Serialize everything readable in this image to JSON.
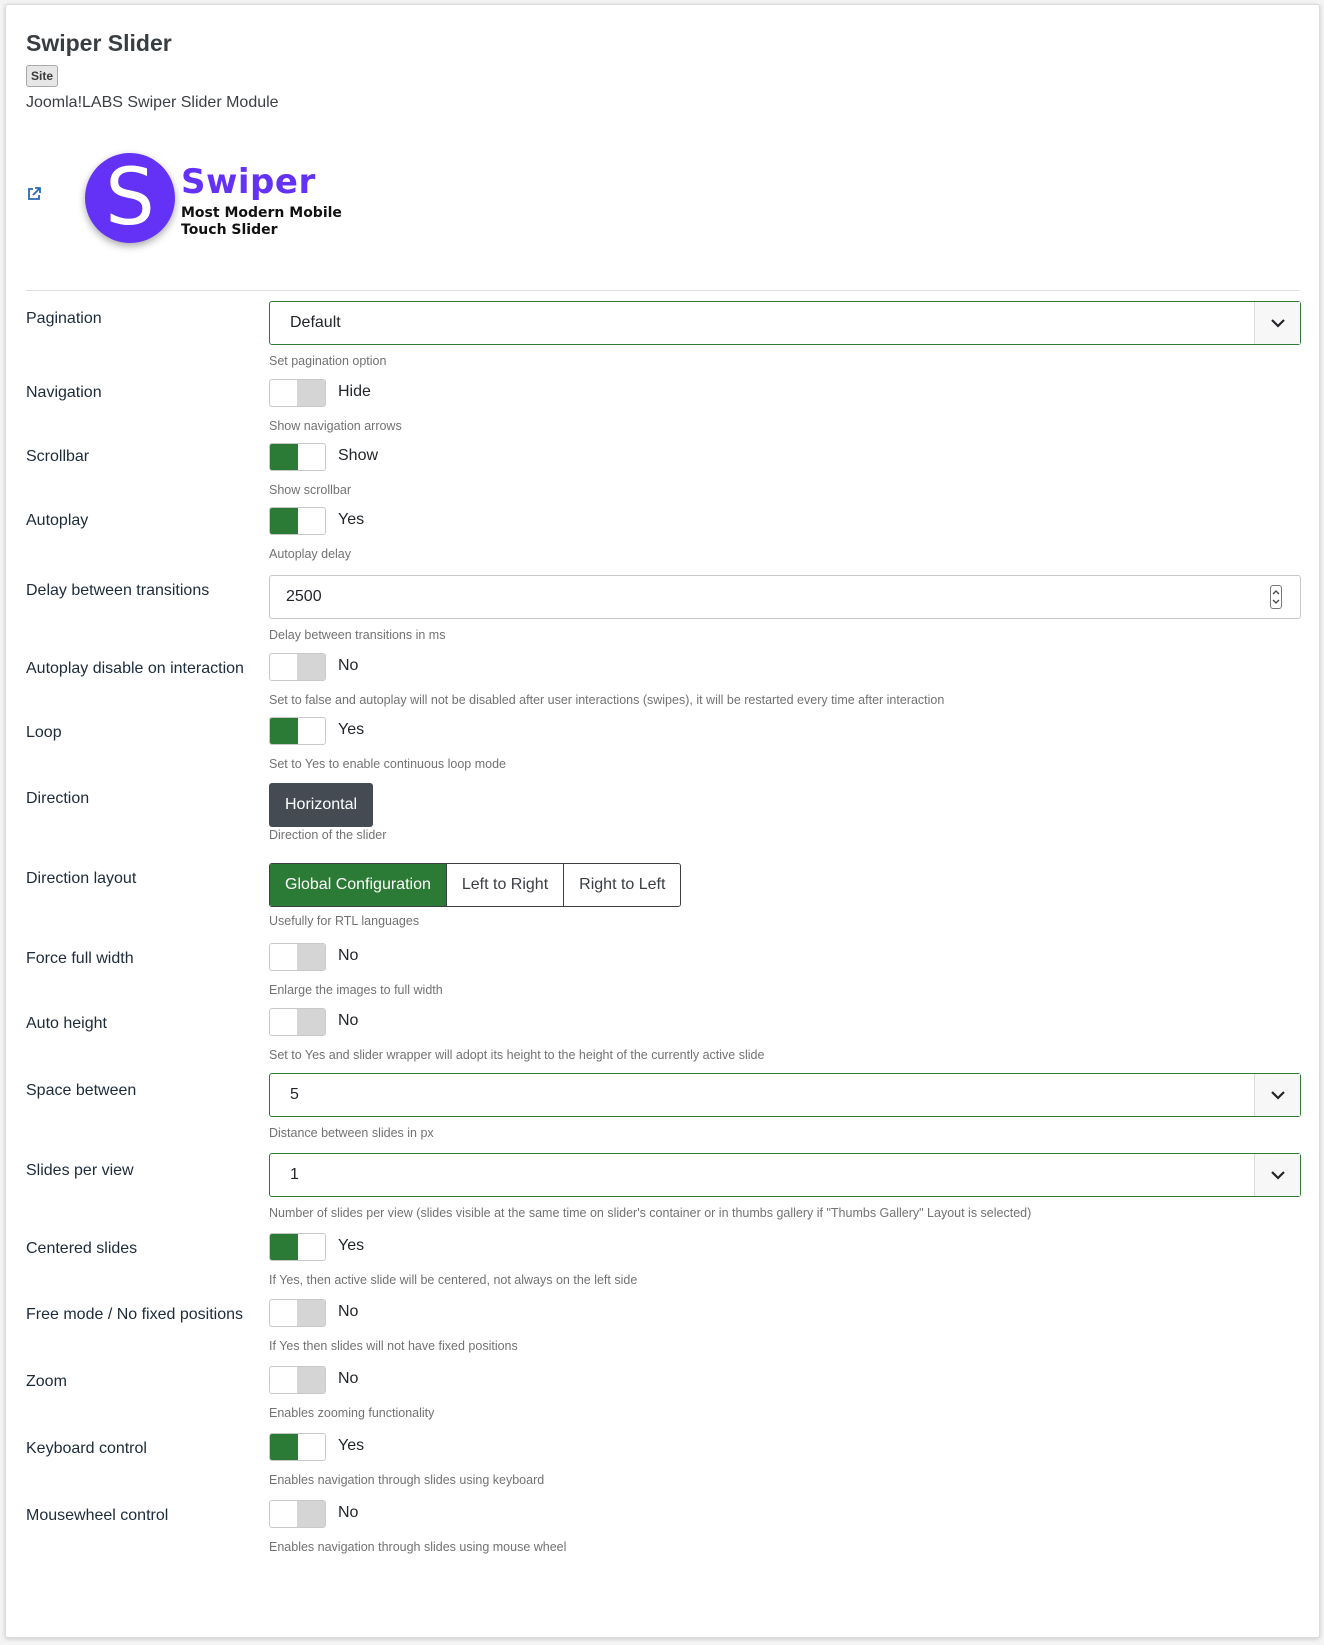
{
  "module": {
    "title": "Swiper Slider",
    "badge": "Site",
    "description": "Joomla!LABS Swiper Slider Module",
    "logo_letter": "S",
    "logo_word": "Swiper",
    "logo_tagline_1": "Most Modern Mobile",
    "logo_tagline_2": "Touch Slider"
  },
  "colors": {
    "accent_green": "#2b7a35",
    "swiper_purple": "#6332f6",
    "dark_button": "#454b52"
  },
  "fields": {
    "pagination": {
      "label": "Pagination",
      "value": "Default",
      "help": "Set pagination option"
    },
    "navigation": {
      "label": "Navigation",
      "state": "Hide",
      "help": "Show navigation arrows"
    },
    "scrollbar": {
      "label": "Scrollbar",
      "state": "Show",
      "help": "Show scrollbar"
    },
    "autoplay": {
      "label": "Autoplay",
      "state": "Yes",
      "help": "Autoplay delay"
    },
    "delay": {
      "label": "Delay between transitions",
      "value": "2500",
      "help": "Delay between transitions in ms"
    },
    "autoplay_disable": {
      "label": "Autoplay disable on interaction",
      "state": "No",
      "help": "Set to false and autoplay will not be disabled after user interactions (swipes), it will be restarted every time after interaction"
    },
    "loop": {
      "label": "Loop",
      "state": "Yes",
      "help": "Set to Yes to enable continuous loop mode"
    },
    "direction": {
      "label": "Direction",
      "value": "Horizontal",
      "help": "Direction of the slider"
    },
    "direction_layout": {
      "label": "Direction layout",
      "options": [
        "Global Configuration",
        "Left to Right",
        "Right to Left"
      ],
      "selected": "Global Configuration",
      "help": "Usefully for RTL languages"
    },
    "force_full_width": {
      "label": "Force full width",
      "state": "No",
      "help": "Enlarge the images to full width"
    },
    "auto_height": {
      "label": "Auto height",
      "state": "No",
      "help": "Set to Yes and slider wrapper will adopt its height to the height of the currently active slide"
    },
    "space_between": {
      "label": "Space between",
      "value": "5",
      "help": "Distance between slides in px"
    },
    "slides_per_view": {
      "label": "Slides per view",
      "value": "1",
      "help": "Number of slides per view (slides visible at the same time on slider's container or in thumbs gallery if \"Thumbs Gallery\" Layout is selected)"
    },
    "centered_slides": {
      "label": "Centered slides",
      "state": "Yes",
      "help": "If Yes, then active slide will be centered, not always on the left side"
    },
    "free_mode": {
      "label": "Free mode / No fixed positions",
      "state": "No",
      "help": "If Yes then slides will not have fixed positions"
    },
    "zoom": {
      "label": "Zoom",
      "state": "No",
      "help": "Enables zooming functionality"
    },
    "keyboard": {
      "label": "Keyboard control",
      "state": "Yes",
      "help": "Enables navigation through slides using keyboard"
    },
    "mousewheel": {
      "label": "Mousewheel control",
      "state": "No",
      "help": "Enables navigation through slides using mouse wheel"
    }
  }
}
